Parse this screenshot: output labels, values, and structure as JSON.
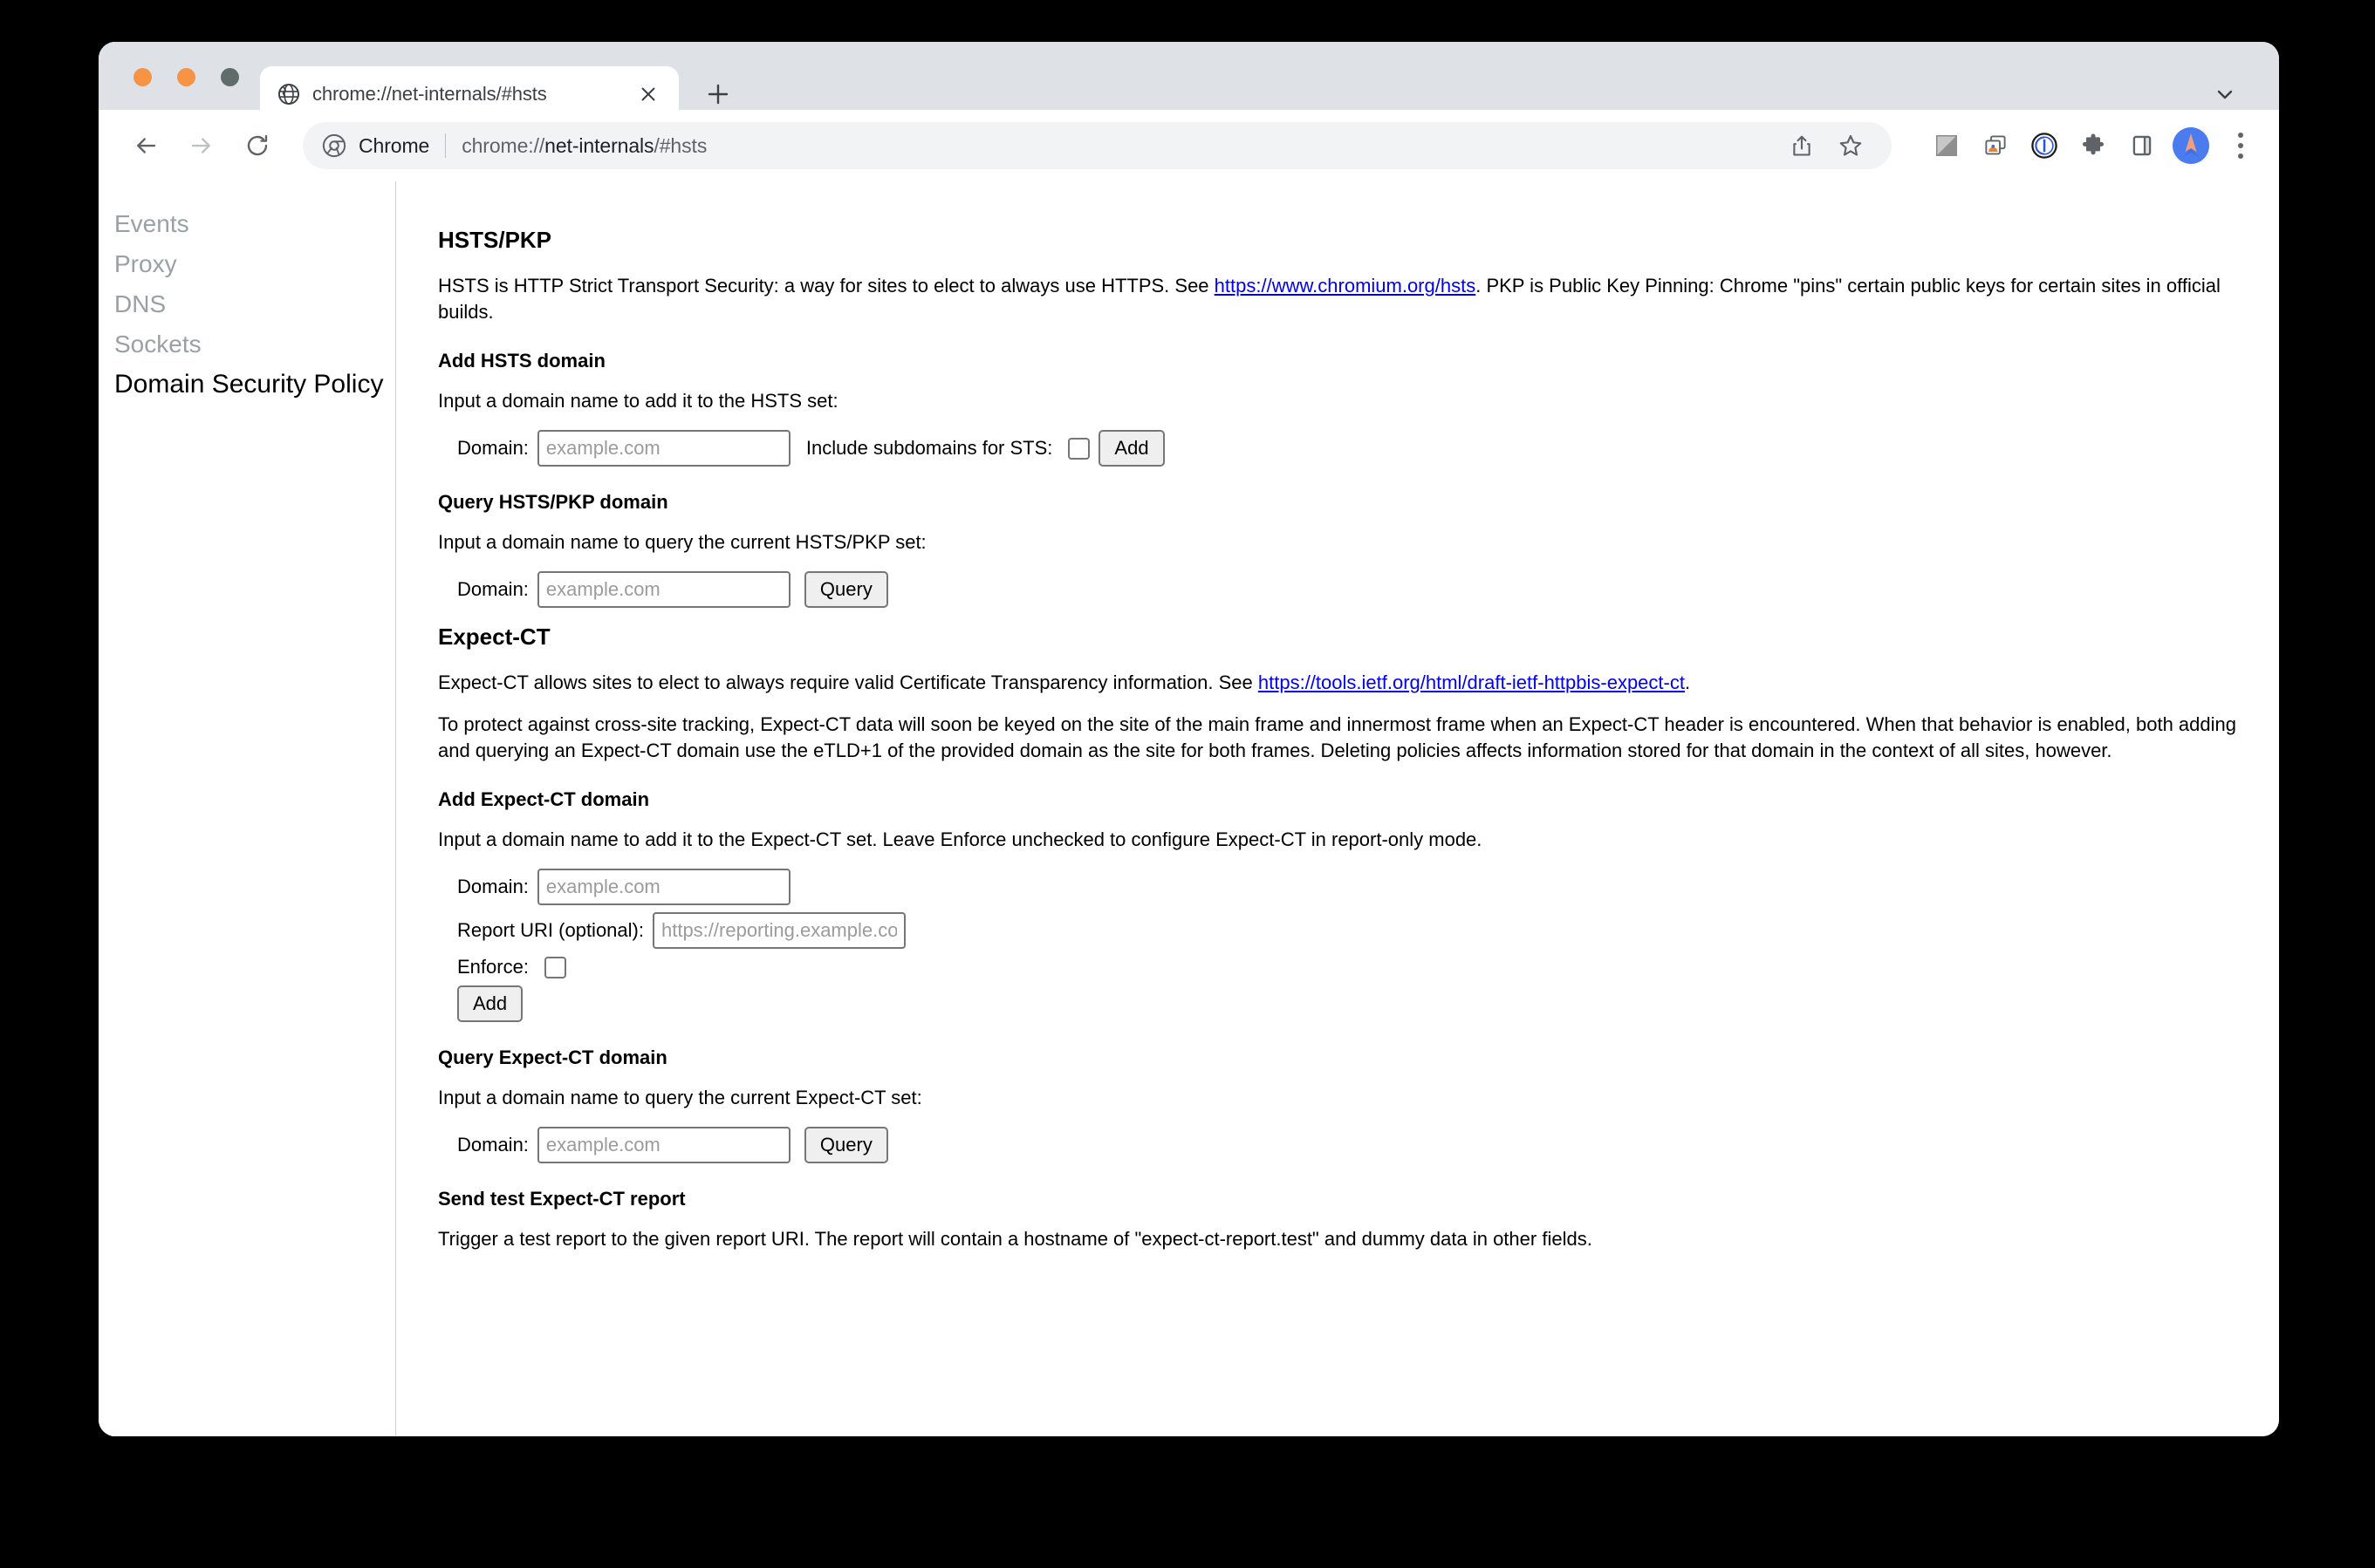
{
  "window": {
    "traffic_lights": [
      "close",
      "minimize",
      "maximize"
    ],
    "tab": {
      "favicon": "globe-icon",
      "title": "chrome://net-internals/#hsts",
      "close_label": "×"
    },
    "new_tab_label": "+",
    "tab_list_chevron": "chevron-down-icon"
  },
  "toolbar": {
    "back": "back-arrow-icon",
    "forward": "forward-arrow-icon",
    "reload": "reload-icon",
    "omnibox": {
      "site_icon": "chrome-icon",
      "chip_label": "Chrome",
      "url_prefix": "chrome://",
      "url_strong": "net-internals",
      "url_suffix": "/#hsts"
    },
    "actions": [
      "share-icon",
      "bookmark-star-icon",
      "gradient-square-icon",
      "media-tabs-icon",
      "onepassword-icon",
      "extensions-puzzle-icon",
      "side-panel-icon",
      "avatar",
      "kebab-menu-icon"
    ]
  },
  "sidebar": {
    "items": [
      {
        "label": "Events",
        "active": false
      },
      {
        "label": "Proxy",
        "active": false
      },
      {
        "label": "DNS",
        "active": false
      },
      {
        "label": "Sockets",
        "active": false
      },
      {
        "label": "Domain Security Policy",
        "active": true
      }
    ]
  },
  "main": {
    "hsts": {
      "heading": "HSTS/PKP",
      "intro_before_link": "HSTS is HTTP Strict Transport Security: a way for sites to elect to always use HTTPS. See ",
      "intro_link": "https://www.chromium.org/hsts",
      "intro_after_link": ". PKP is Public Key Pinning: Chrome \"pins\" certain public keys for certain sites in official builds.",
      "add": {
        "heading": "Add HSTS domain",
        "instruction": "Input a domain name to add it to the HSTS set:",
        "domain_label": "Domain:",
        "domain_placeholder": "example.com",
        "domain_value": "",
        "subdomains_label": "Include subdomains for STS:",
        "subdomains_checked": false,
        "add_button": "Add"
      },
      "query": {
        "heading": "Query HSTS/PKP domain",
        "instruction": "Input a domain name to query the current HSTS/PKP set:",
        "domain_label": "Domain:",
        "domain_placeholder": "example.com",
        "domain_value": "",
        "query_button": "Query"
      }
    },
    "expect_ct": {
      "heading": "Expect-CT",
      "intro_before_link": "Expect-CT allows sites to elect to always require valid Certificate Transparency information. See ",
      "intro_link": "https://tools.ietf.org/html/draft-ietf-httpbis-expect-ct",
      "intro_after_link": ".",
      "notice": "To protect against cross-site tracking, Expect-CT data will soon be keyed on the site of the main frame and innermost frame when an Expect-CT header is encountered. When that behavior is enabled, both adding and querying an Expect-CT domain use the eTLD+1 of the provided domain as the site for both frames. Deleting policies affects information stored for that domain in the context of all sites, however.",
      "add": {
        "heading": "Add Expect-CT domain",
        "instruction": "Input a domain name to add it to the Expect-CT set. Leave Enforce unchecked to configure Expect-CT in report-only mode.",
        "domain_label": "Domain:",
        "domain_placeholder": "example.com",
        "domain_value": "",
        "report_uri_label": "Report URI (optional):",
        "report_uri_placeholder": "https://reporting.example.com/log",
        "report_uri_value": "",
        "enforce_label": "Enforce:",
        "enforce_checked": false,
        "add_button": "Add"
      },
      "query": {
        "heading": "Query Expect-CT domain",
        "instruction": "Input a domain name to query the current Expect-CT set:",
        "domain_label": "Domain:",
        "domain_placeholder": "example.com",
        "domain_value": "",
        "query_button": "Query"
      },
      "send_report": {
        "heading": "Send test Expect-CT report",
        "instruction": "Trigger a test report to the given report URI. The report will contain a hostname of \"expect-ct-report.test\" and dummy data in other fields."
      }
    }
  },
  "colors": {
    "chrome_frame": "#dee1e6",
    "link": "#0000ee",
    "muted_text": "#9aa0a6",
    "traffic_orange": "#f79345",
    "traffic_gray": "#5f6c6a",
    "avatar_blue": "#4a7cf0"
  }
}
